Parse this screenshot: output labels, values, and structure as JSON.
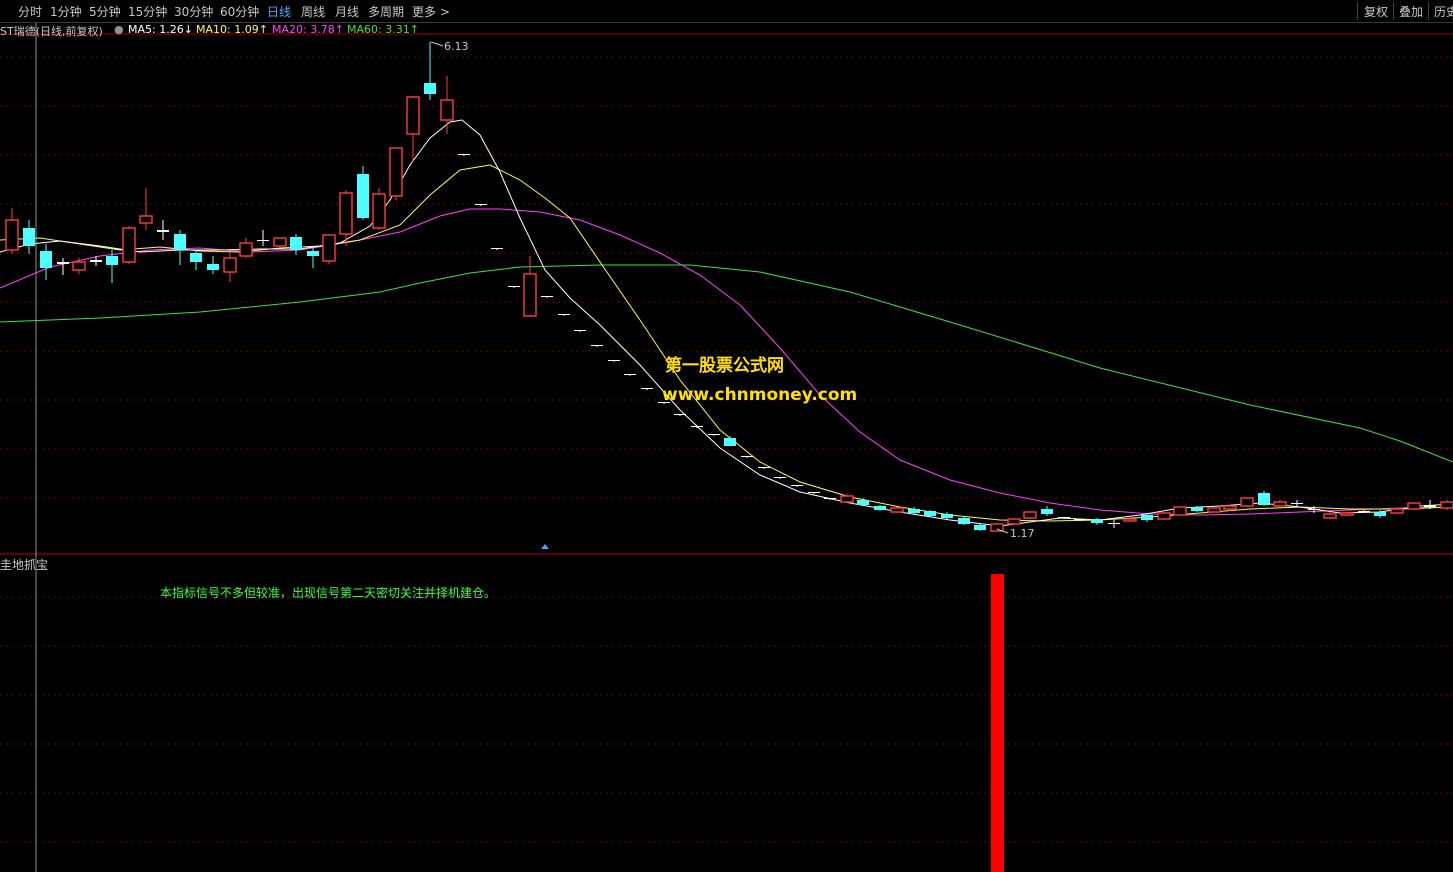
{
  "toolbar": {
    "periods": [
      "分时",
      "1分钟",
      "5分钟",
      "15分钟",
      "30分钟",
      "60分钟",
      "日线",
      "周线",
      "月线",
      "多周期",
      "更多 >"
    ],
    "active_period": "日线",
    "right_buttons": [
      "复权",
      "叠加",
      "历史"
    ]
  },
  "legend": {
    "stock": "ST瑞德(日线,前复权)",
    "ma5": "MA5: 1.26↓",
    "ma10": "MA10: 1.09↑",
    "ma20": "MA20: 3.78↑",
    "ma60": "MA60: 3.31↑"
  },
  "colors": {
    "up": "#ff3c3c",
    "down": "#4fffff",
    "ma5": "#ffffff",
    "ma10": "#ffff40",
    "ma20": "#ff40ff",
    "ma60": "#40e040",
    "signal": "#ff0000",
    "grid": "#7a0000"
  },
  "annotations": {
    "high": "6.13",
    "low": "1.17"
  },
  "watermark": {
    "line1": "第一股票公式网",
    "line2": "www.chnmoney.com"
  },
  "sub_panel": {
    "title": "圭地抓宝",
    "note": "本指标信号不多但较准，出现信号第二天密切关注并择机建仓。"
  }
}
